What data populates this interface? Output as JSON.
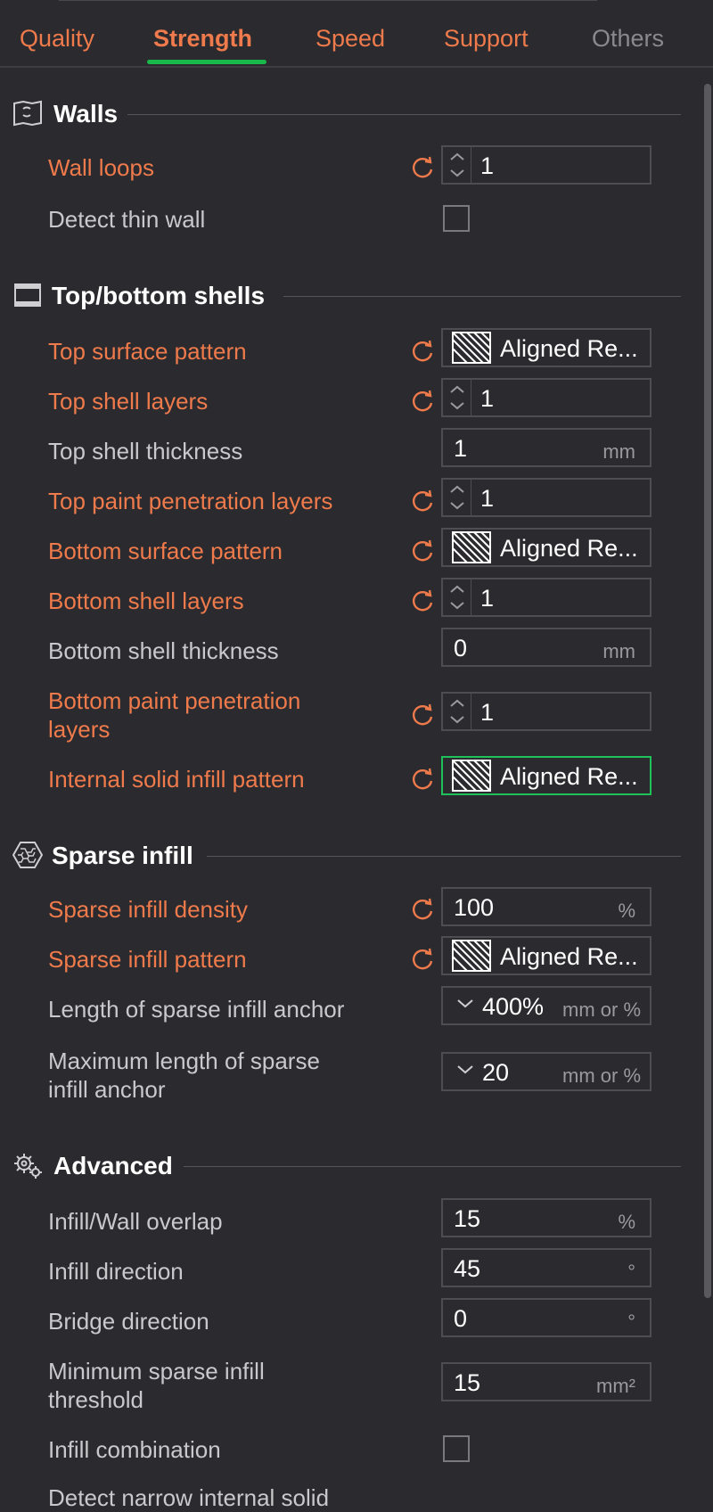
{
  "tabs": [
    {
      "label": "Quality",
      "state": "normal"
    },
    {
      "label": "Strength",
      "state": "active"
    },
    {
      "label": "Speed",
      "state": "normal"
    },
    {
      "label": "Support",
      "state": "normal"
    },
    {
      "label": "Others",
      "state": "muted"
    }
  ],
  "colors": {
    "modified": "#ef7a4b",
    "active_underline": "#19b84a",
    "focus_border": "#1ec15a",
    "background": "#2b2b2f"
  },
  "sections": {
    "walls": {
      "title": "Walls",
      "icon": "walls-icon"
    },
    "top_bottom": {
      "title": "Top/bottom shells",
      "icon": "shells-icon"
    },
    "sparse": {
      "title": "Sparse infill",
      "icon": "honeycomb-icon"
    },
    "advanced": {
      "title": "Advanced",
      "icon": "gear-icon"
    }
  },
  "settings": {
    "wall_loops": {
      "label": "Wall loops",
      "value": "1"
    },
    "detect_thin_wall": {
      "label": "Detect thin wall",
      "checked": false
    },
    "top_surface_pattern": {
      "label": "Top surface pattern",
      "value": "Aligned Re..."
    },
    "top_shell_layers": {
      "label": "Top shell layers",
      "value": "1"
    },
    "top_shell_thickness": {
      "label": "Top shell thickness",
      "value": "1",
      "unit": "mm"
    },
    "top_paint_penetration_layers": {
      "label": "Top paint penetration layers",
      "value": "1"
    },
    "bottom_surface_pattern": {
      "label": "Bottom surface pattern",
      "value": "Aligned Re..."
    },
    "bottom_shell_layers": {
      "label": "Bottom shell layers",
      "value": "1"
    },
    "bottom_shell_thickness": {
      "label": "Bottom shell thickness",
      "value": "0",
      "unit": "mm"
    },
    "bottom_paint_penetration_layers": {
      "label_line1": "Bottom paint penetration",
      "label_line2": "layers",
      "value": "1"
    },
    "internal_solid_infill_pattern": {
      "label": "Internal solid infill pattern",
      "value": "Aligned Re..."
    },
    "sparse_infill_density": {
      "label": "Sparse infill density",
      "value": "100",
      "unit": "%"
    },
    "sparse_infill_pattern": {
      "label": "Sparse infill pattern",
      "value": "Aligned Re..."
    },
    "sparse_infill_anchor": {
      "label": "Length of sparse infill anchor",
      "value": "400%",
      "unit": "mm or %"
    },
    "sparse_infill_anchor_max": {
      "label_line1": "Maximum length of sparse",
      "label_line2": "infill anchor",
      "value": "20",
      "unit": "mm or %"
    },
    "infill_wall_overlap": {
      "label": "Infill/Wall overlap",
      "value": "15",
      "unit": "%"
    },
    "infill_direction": {
      "label": "Infill direction",
      "value": "45",
      "unit": "°"
    },
    "bridge_direction": {
      "label": "Bridge direction",
      "value": "0",
      "unit": "°"
    },
    "min_sparse_infill_threshold": {
      "label_line1": "Minimum sparse infill",
      "label_line2": "threshold",
      "value": "15",
      "unit": "mm²"
    },
    "infill_combination": {
      "label": "Infill combination",
      "checked": false
    },
    "cut_off_label": {
      "label": "Detect narrow internal solid"
    }
  }
}
